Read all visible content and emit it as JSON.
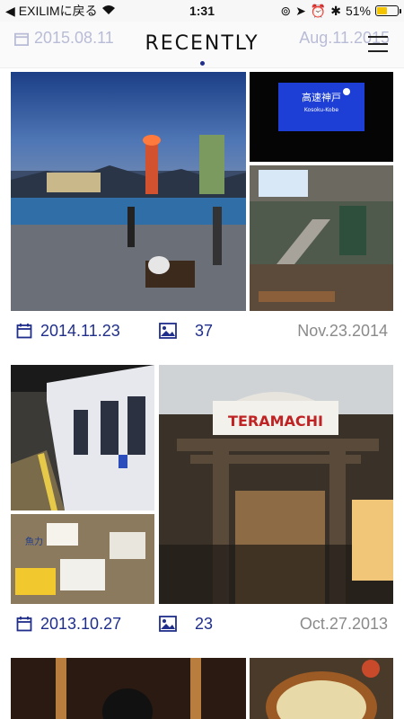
{
  "status_bar": {
    "back_label": "EXILIMに戻る",
    "time": "1:31",
    "battery_percent": "51%",
    "battery_level": 0.51
  },
  "header": {
    "title": "RECENTLY",
    "ghost_left_date": "2015.08.11",
    "ghost_right_date": "Aug.11.2015"
  },
  "albums": [
    {
      "date": "2014.11.23",
      "count": "37",
      "date_long": "Nov.23.2014"
    },
    {
      "date": "2013.10.27",
      "count": "23",
      "date_long": "Oct.27.2013"
    }
  ],
  "signs": {
    "station_main": "高速神戸",
    "station_romaji": "Kosoku-Kobe",
    "arcade": "TERAMACHI",
    "food_label": "魚力"
  },
  "colors": {
    "accent": "#1f2e8a",
    "muted": "#8a8a8a"
  }
}
